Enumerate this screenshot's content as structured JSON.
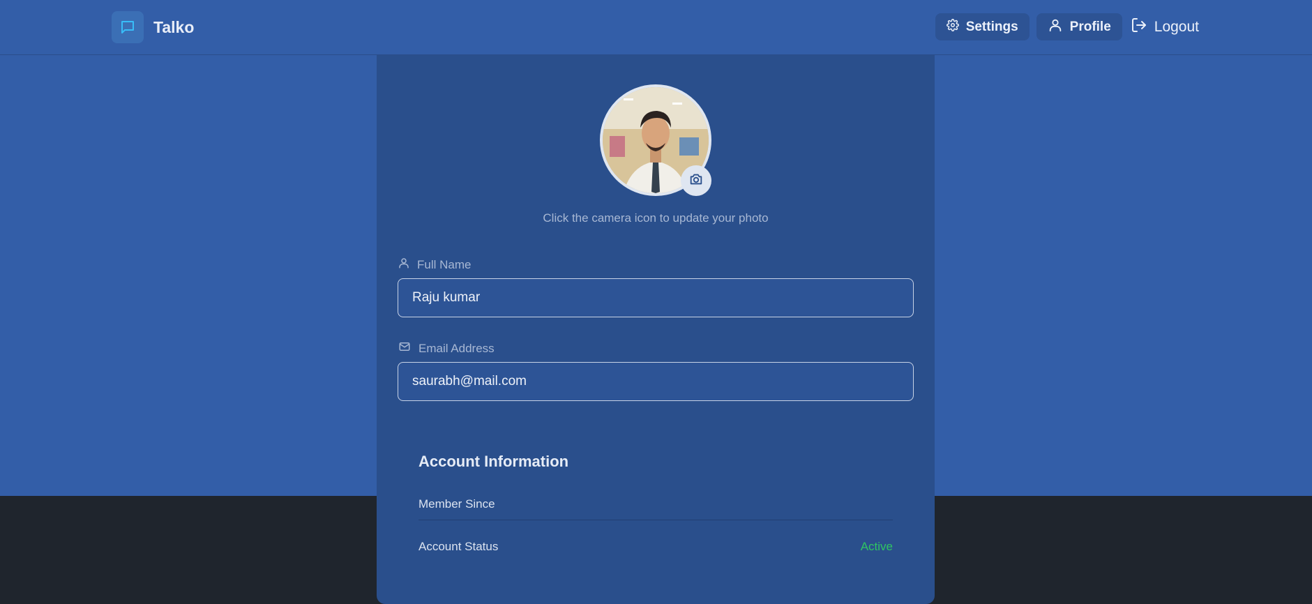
{
  "app": {
    "name": "Talko"
  },
  "nav": {
    "settings_label": "Settings",
    "profile_label": "Profile",
    "logout_label": "Logout"
  },
  "profile": {
    "photo_hint": "Click the camera icon to update your photo",
    "full_name_label": "Full Name",
    "full_name_value": "Raju kumar",
    "email_label": "Email Address",
    "email_value": "saurabh@mail.com"
  },
  "account_info": {
    "title": "Account Information",
    "member_since_label": "Member Since",
    "status_label": "Account Status",
    "status_value": "Active"
  },
  "icons": {
    "brand": "chat-bubble-icon",
    "settings": "gear-icon",
    "profile": "user-icon",
    "logout": "logout-icon",
    "camera": "camera-icon",
    "name_field": "user-icon",
    "email_field": "mail-icon"
  },
  "colors": {
    "background": "#335ea8",
    "card": "#2a4f8c",
    "footer": "#1f252d",
    "accent": "#38bdf8",
    "status_active": "#2fc562"
  }
}
